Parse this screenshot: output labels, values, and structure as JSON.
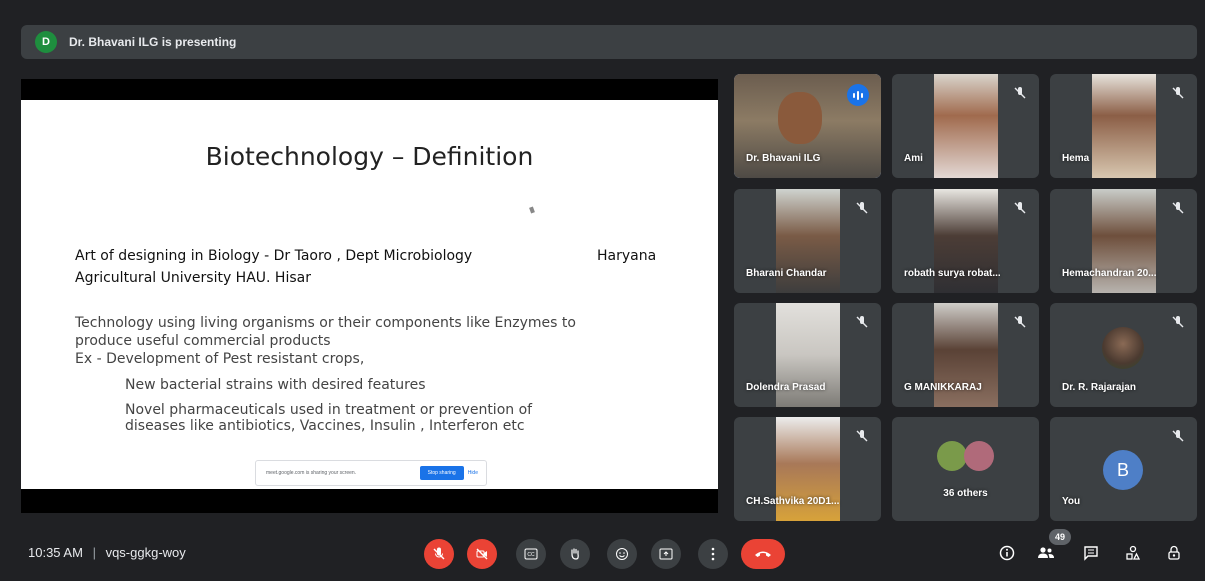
{
  "banner": {
    "avatar_letter": "D",
    "text": "Dr. Bhavani ILG is presenting"
  },
  "slide": {
    "title": "Biotechnology – Definition",
    "lines": [
      "Art of designing in Biology - Dr Taoro , Dept Microbiology",
      "Haryana",
      "Agricultural University HAU. Hisar",
      "Technology using  living organisms or their components like Enzymes to",
      "produce useful  commercial products",
      "Ex - Development of Pest resistant crops,",
      "New bacterial strains with desired features",
      "Novel pharmaceuticals used in treatment or prevention of",
      "diseases like antibiotics, Vaccines, Insulin , Interferon etc"
    ],
    "share_bar": {
      "text": "meet.google.com is sharing your screen.",
      "stop_label": "Stop sharing",
      "hide_label": "Hide"
    }
  },
  "participants": [
    {
      "name": "Dr. Bhavani ILG",
      "speaking": true
    },
    {
      "name": "Ami",
      "muted": true
    },
    {
      "name": "Hema",
      "muted": true
    },
    {
      "name": "Bharani Chandar",
      "muted": true
    },
    {
      "name": "robath surya robat...",
      "muted": true
    },
    {
      "name": "Hemachandran 20...",
      "muted": true
    },
    {
      "name": "Dolendra Prasad",
      "muted": true
    },
    {
      "name": "G MANIKKARAJ",
      "muted": true
    },
    {
      "name": "Dr. R. Rajarajan",
      "muted": true
    },
    {
      "name": "CH.Sathvika 20D1...",
      "muted": true
    },
    {
      "name": "36 others"
    },
    {
      "name": "You",
      "avatar_letter": "B",
      "muted": true
    }
  ],
  "bottom": {
    "time": "10:35 AM",
    "separator": "|",
    "meeting_code": "vqs-ggkg-woy",
    "people_count": "49"
  },
  "colors": {
    "background": "#202124",
    "tile": "#3c4043",
    "danger": "#ea4335",
    "accent": "#1a73e8",
    "active_outline": "#8ab4f8"
  }
}
